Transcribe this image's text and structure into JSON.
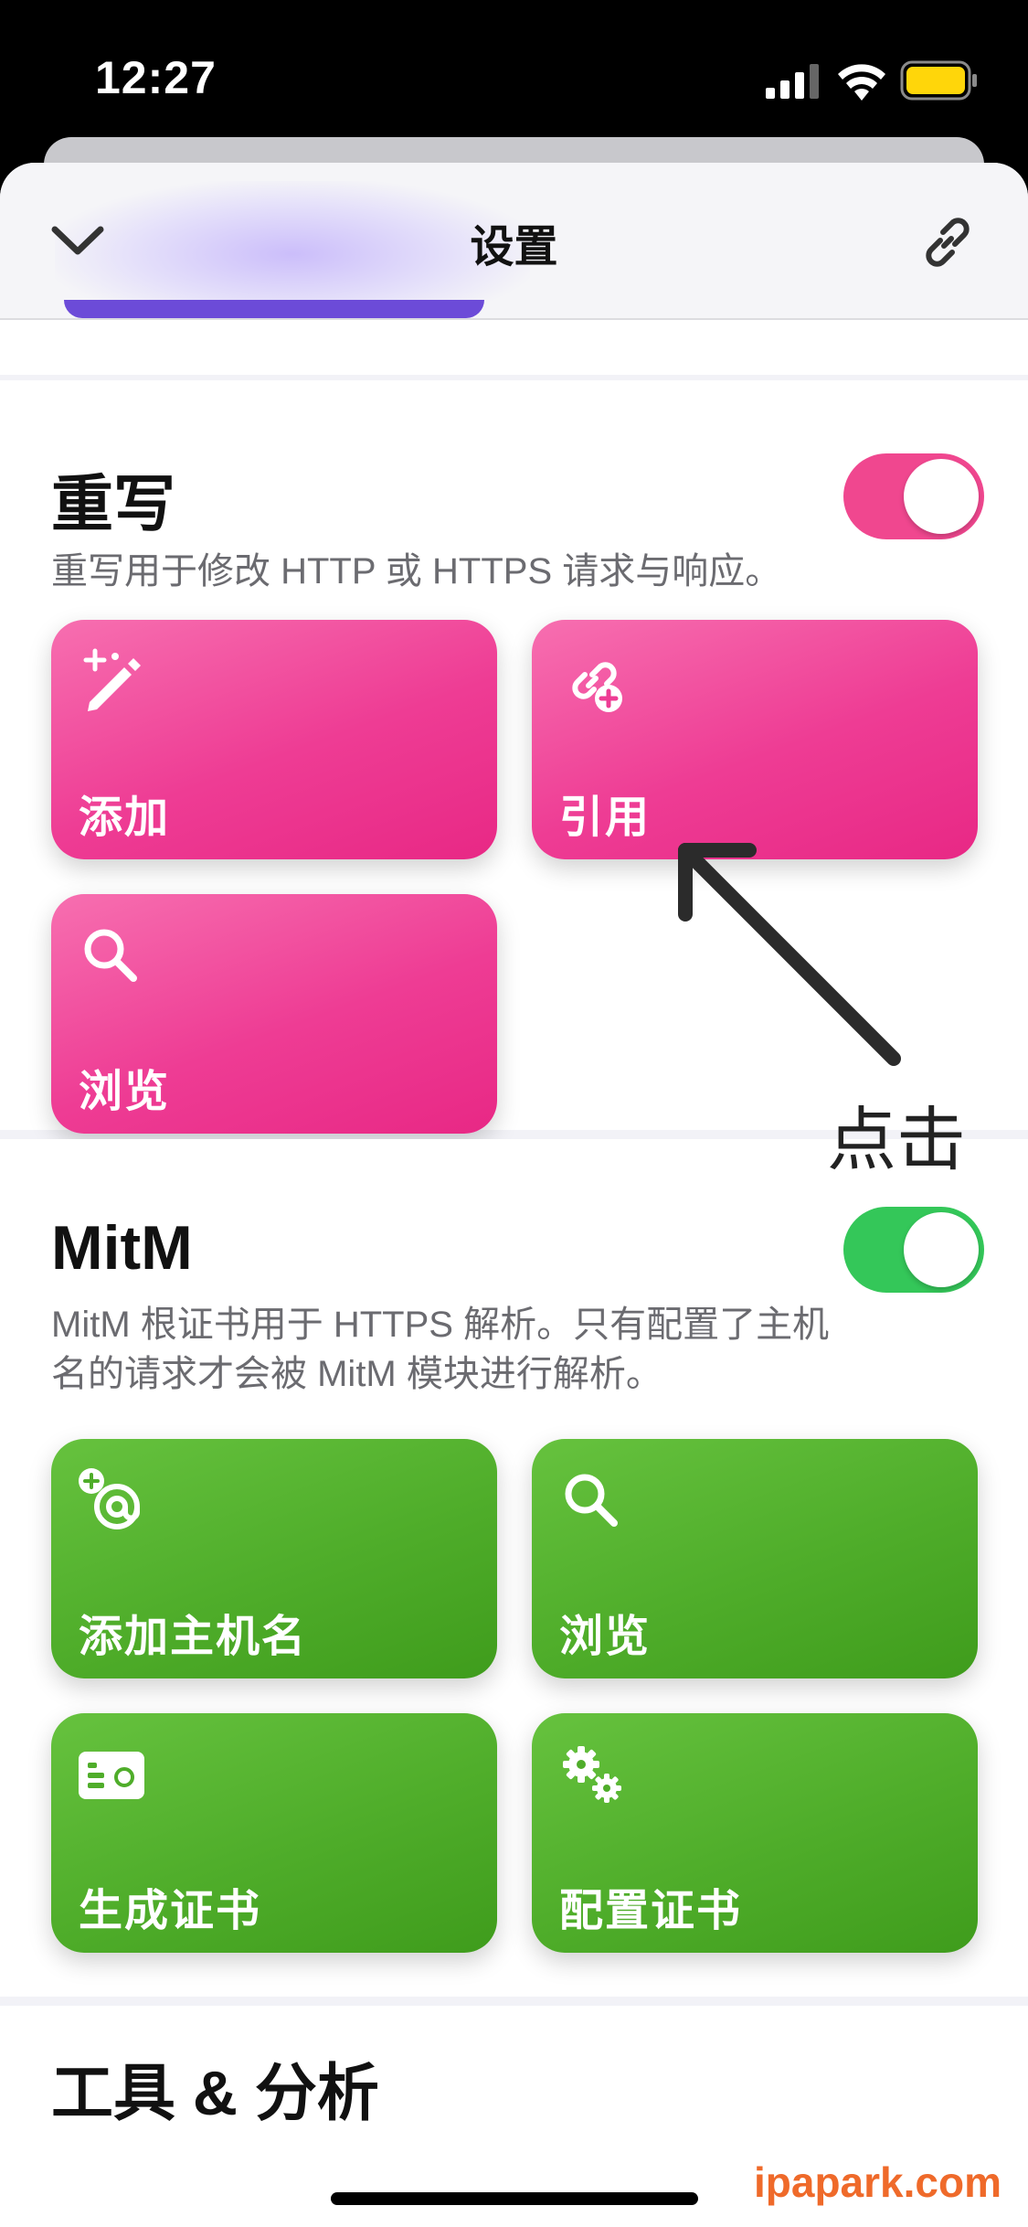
{
  "status_bar": {
    "time": "12:27",
    "signal_icon": "cellular-signal-icon",
    "wifi_icon": "wifi-icon",
    "battery_icon": "battery-icon",
    "battery_color": "#ffd60a"
  },
  "nav": {
    "title": "设置",
    "back_icon": "chevron-down-icon",
    "link_icon": "link-icon"
  },
  "rewrite": {
    "title": "重写",
    "description": "重写用于修改 HTTP 或 HTTPS 请求与响应。",
    "enabled": true,
    "toggle_color": "#f0478f",
    "tiles": [
      {
        "label": "添加",
        "icon": "magic-wand-pencil-icon"
      },
      {
        "label": "引用",
        "icon": "link-plus-icon"
      },
      {
        "label": "浏览",
        "icon": "search-icon"
      }
    ]
  },
  "annotation": {
    "text": "点击",
    "arrow_icon": "arrow-up-left-icon"
  },
  "mitm": {
    "title": "MitM",
    "description_line1": "MitM 根证书用于 HTTPS 解析。只有配置了主机",
    "description_line2": "名的请求才会被 MitM 模块进行解析。",
    "enabled": true,
    "toggle_color": "#34c759",
    "tiles": [
      {
        "label": "添加主机名",
        "icon": "add-at-icon"
      },
      {
        "label": "浏览",
        "icon": "search-icon"
      },
      {
        "label": "生成证书",
        "icon": "certificate-card-icon"
      },
      {
        "label": "配置证书",
        "icon": "gears-icon"
      }
    ]
  },
  "tools": {
    "title": "工具 & 分析"
  },
  "watermark": "ipapark.com"
}
